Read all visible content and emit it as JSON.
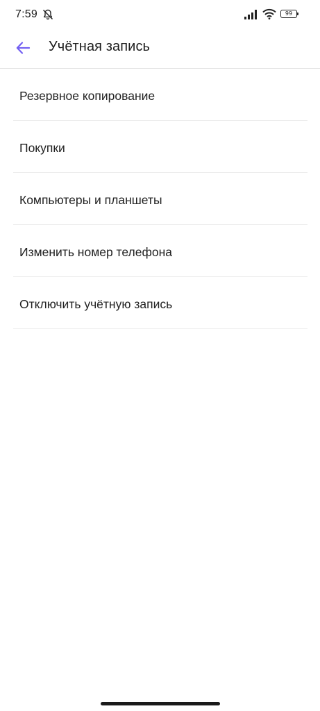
{
  "status_bar": {
    "time": "7:59",
    "battery_level": "99",
    "icons": [
      "mute-bell-icon",
      "signal-icon",
      "wifi-icon",
      "battery-icon"
    ]
  },
  "app_bar": {
    "title": "Учётная запись",
    "back_icon": "arrow-left-icon",
    "accent_color": "#7360f2"
  },
  "settings": {
    "items": [
      {
        "label": "Резервное копирование"
      },
      {
        "label": "Покупки"
      },
      {
        "label": "Компьютеры и планшеты"
      },
      {
        "label": "Изменить номер телефона"
      },
      {
        "label": "Отключить учётную запись"
      }
    ]
  }
}
